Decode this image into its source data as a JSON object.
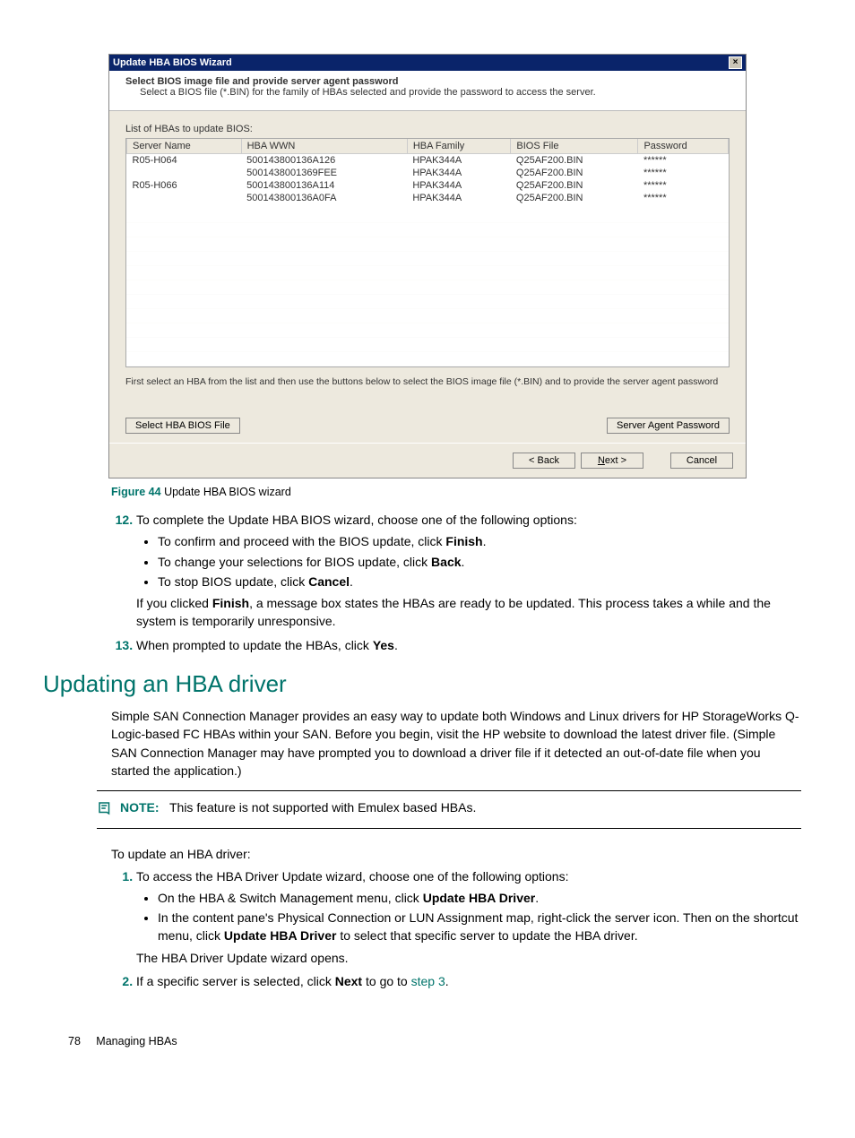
{
  "wizard": {
    "title": "Update HBA BIOS Wizard",
    "close_glyph": "×",
    "header_title": "Select BIOS image file and provide server agent password",
    "header_sub": "Select a BIOS file (*.BIN) for the family of HBAs selected and provide the password to access the server.",
    "list_label": "List of HBAs to update BIOS:",
    "columns": {
      "server": "Server Name",
      "wwn": "HBA WWN",
      "family": "HBA Family",
      "file": "BIOS File",
      "password": "Password"
    },
    "rows": [
      {
        "server": "R05-H064",
        "wwn": "500143800136A126",
        "family": "HPAK344A",
        "file": "Q25AF200.BIN",
        "password": "******"
      },
      {
        "server": "",
        "wwn": "5001438001369FEE",
        "family": "HPAK344A",
        "file": "Q25AF200.BIN",
        "password": "******"
      },
      {
        "server": "R05-H066",
        "wwn": "500143800136A114",
        "family": "HPAK344A",
        "file": "Q25AF200.BIN",
        "password": "******"
      },
      {
        "server": "",
        "wwn": "500143800136A0FA",
        "family": "HPAK344A",
        "file": "Q25AF200.BIN",
        "password": "******"
      }
    ],
    "instruction": "First select an HBA from the list and then use the buttons below to select the BIOS image file (*.BIN) and to provide the server agent password",
    "select_file_btn": "Select HBA BIOS File",
    "agent_pwd_btn": "Server Agent Password",
    "back_btn": "< Back",
    "next_btn": "Next >",
    "cancel_btn": "Cancel"
  },
  "figure": {
    "label": "Figure 44",
    "caption": "Update HBA BIOS wizard"
  },
  "steps_a": {
    "s12": "To complete the Update HBA BIOS wizard, choose one of the following options:",
    "b1a": "To confirm and proceed with the BIOS update, click ",
    "b1b": "Finish",
    "b1c": ".",
    "b2a": "To change your selections for BIOS update, click ",
    "b2b": "Back",
    "b2c": ".",
    "b3a": "To stop BIOS update, click ",
    "b3b": "Cancel",
    "b3c": ".",
    "post_a": "If you clicked ",
    "post_b": "Finish",
    "post_c": ", a message box states the HBAs are ready to be updated. This process takes a while and the system is temporarily unresponsive.",
    "s13a": "When prompted to update the HBAs, click ",
    "s13b": "Yes",
    "s13c": "."
  },
  "section_title": "Updating an HBA driver",
  "section_para": "Simple SAN Connection Manager provides an easy way to update both Windows and Linux drivers for HP StorageWorks Q-Logic-based FC HBAs within your SAN. Before you begin, visit the HP website to download the latest driver file. (Simple SAN Connection Manager may have prompted you to download a driver file if it detected an out-of-date file when you started the application.)",
  "note": {
    "label": "NOTE:",
    "text": "This feature is not supported with Emulex based HBAs."
  },
  "lead_in": "To update an HBA driver:",
  "steps_b": {
    "s1": "To access the HBA Driver Update wizard, choose one of the following options:",
    "b1a": "On the HBA & Switch Management menu, click ",
    "b1b": "Update HBA Driver",
    "b1c": ".",
    "b2a": "In the content pane's Physical Connection or LUN Assignment map, right-click the server icon. Then on the shortcut menu, click ",
    "b2b": "Update HBA Driver",
    "b2c": " to select that specific server to update the HBA driver.",
    "opens": "The HBA Driver Update wizard opens.",
    "s2a": "If a specific server is selected, click ",
    "s2b": "Next",
    "s2c": " to go to ",
    "s2d": "step 3",
    "s2e": "."
  },
  "footer": {
    "page": "78",
    "title": "Managing HBAs"
  }
}
